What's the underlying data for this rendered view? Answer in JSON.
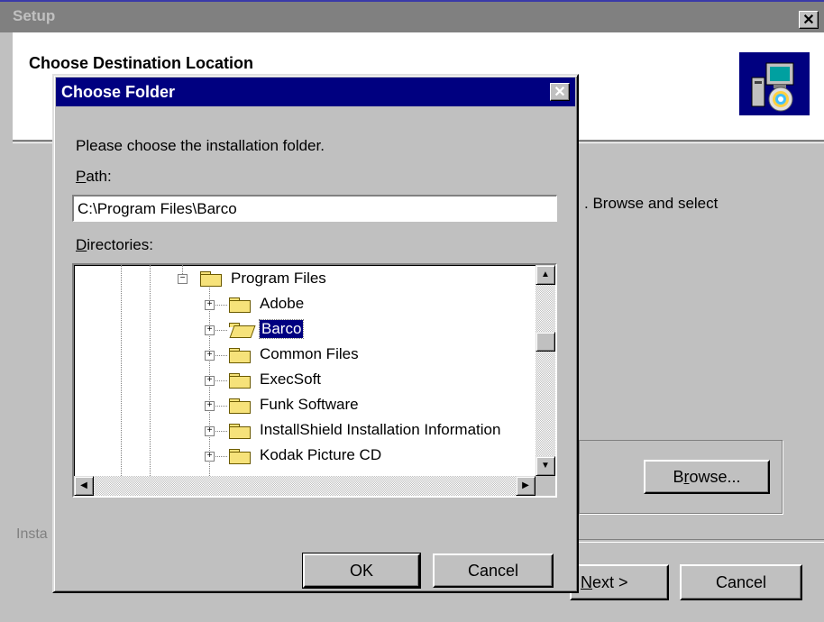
{
  "setup": {
    "title": "Setup",
    "header": "Choose Destination Location",
    "body_text": ". Browse and select",
    "browse_label_pre": "B",
    "browse_label_u": "r",
    "browse_label_post": "owse...",
    "install_label": "Insta",
    "next_label_u": "N",
    "next_label_post": "ext >",
    "cancel_label": "Cancel",
    "close_glyph": "✕"
  },
  "dialog": {
    "title": "Choose Folder",
    "close_glyph": "✕",
    "prompt": "Please choose the installation folder.",
    "path_label_u": "P",
    "path_label_rest": "ath:",
    "path_value": "C:\\Program Files\\Barco",
    "dirs_label_u": "D",
    "dirs_label_rest": "irectories:",
    "ok_label": "OK",
    "cancel_label": "Cancel"
  },
  "tree": {
    "parent": "Program Files",
    "children": [
      {
        "label": "Adobe",
        "selected": false,
        "open": false
      },
      {
        "label": "Barco",
        "selected": true,
        "open": true
      },
      {
        "label": "Common Files",
        "selected": false,
        "open": false
      },
      {
        "label": "ExecSoft",
        "selected": false,
        "open": false
      },
      {
        "label": "Funk Software",
        "selected": false,
        "open": false
      },
      {
        "label": "InstallShield Installation Information",
        "selected": false,
        "open": false
      },
      {
        "label": "Kodak Picture CD",
        "selected": false,
        "open": false
      }
    ]
  },
  "scroll": {
    "up": "▲",
    "down": "▼",
    "left": "◀",
    "right": "▶"
  },
  "expander": {
    "minus": "−",
    "plus": "+"
  }
}
